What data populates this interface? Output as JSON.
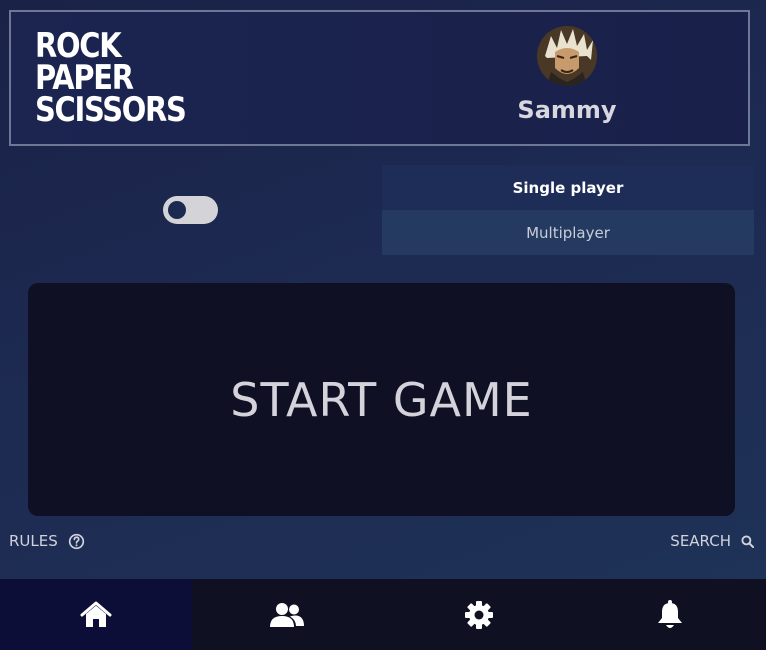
{
  "header": {
    "logo_lines": [
      "ROCK",
      "PAPER",
      "SCISSORS"
    ],
    "username": "Sammy",
    "avatar_icon": "user-avatar"
  },
  "toggle": {
    "state": "off"
  },
  "modes": [
    {
      "label": "Single player",
      "active": true
    },
    {
      "label": "Multiplayer",
      "active": false
    }
  ],
  "start_button": {
    "label": "START GAME"
  },
  "footer_links": {
    "rules_label": "RULES",
    "search_label": "SEARCH"
  },
  "nav": [
    {
      "icon": "home-icon",
      "active": true
    },
    {
      "icon": "users-icon",
      "active": false
    },
    {
      "icon": "gear-icon",
      "active": false
    },
    {
      "icon": "bell-icon",
      "active": false
    }
  ],
  "colors": {
    "background": "#1d2a52",
    "start_panel": "#0f1024",
    "nav_active": "#0c0e38",
    "mode_active": "#1e2c58",
    "mode_inactive": "#253a60"
  }
}
